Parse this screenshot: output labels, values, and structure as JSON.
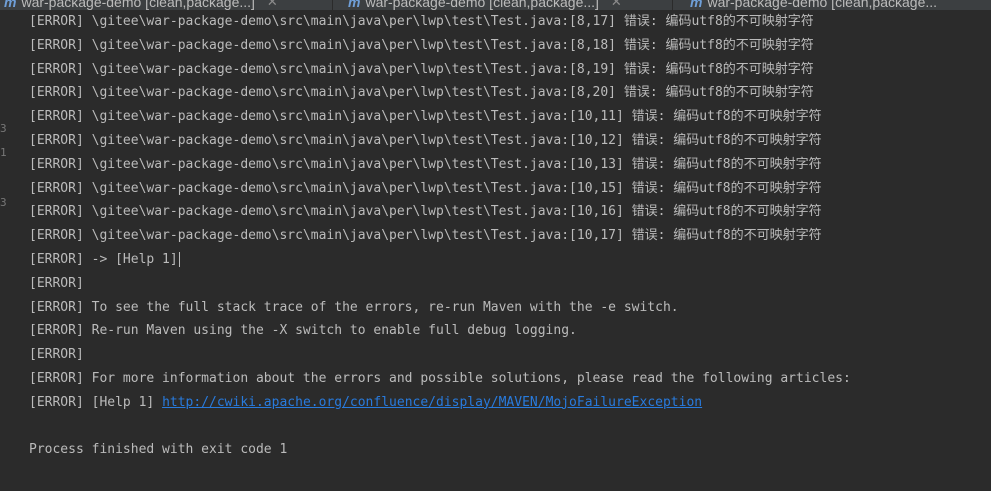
{
  "tabs": [
    {
      "label": "war-package-demo [clean,package...]"
    },
    {
      "label": "war-package-demo [clean,package...]"
    },
    {
      "label": "war-package-demo [clean,package..."
    }
  ],
  "console": {
    "lines": [
      {
        "text": "[ERROR] \\gitee\\war-package-demo\\src\\main\\java\\per\\lwp\\test\\Test.java:[8,17] 错误: 编码utf8的不可映射字符"
      },
      {
        "text": "[ERROR] \\gitee\\war-package-demo\\src\\main\\java\\per\\lwp\\test\\Test.java:[8,18] 错误: 编码utf8的不可映射字符"
      },
      {
        "text": "[ERROR] \\gitee\\war-package-demo\\src\\main\\java\\per\\lwp\\test\\Test.java:[8,19] 错误: 编码utf8的不可映射字符"
      },
      {
        "text": "[ERROR] \\gitee\\war-package-demo\\src\\main\\java\\per\\lwp\\test\\Test.java:[8,20] 错误: 编码utf8的不可映射字符"
      },
      {
        "text": "[ERROR] \\gitee\\war-package-demo\\src\\main\\java\\per\\lwp\\test\\Test.java:[10,11] 错误: 编码utf8的不可映射字符"
      },
      {
        "text": "[ERROR] \\gitee\\war-package-demo\\src\\main\\java\\per\\lwp\\test\\Test.java:[10,12] 错误: 编码utf8的不可映射字符"
      },
      {
        "text": "[ERROR] \\gitee\\war-package-demo\\src\\main\\java\\per\\lwp\\test\\Test.java:[10,13] 错误: 编码utf8的不可映射字符"
      },
      {
        "text": "[ERROR] \\gitee\\war-package-demo\\src\\main\\java\\per\\lwp\\test\\Test.java:[10,15] 错误: 编码utf8的不可映射字符"
      },
      {
        "text": "[ERROR] \\gitee\\war-package-demo\\src\\main\\java\\per\\lwp\\test\\Test.java:[10,16] 错误: 编码utf8的不可映射字符"
      },
      {
        "text": "[ERROR] \\gitee\\war-package-demo\\src\\main\\java\\per\\lwp\\test\\Test.java:[10,17] 错误: 编码utf8的不可映射字符"
      },
      {
        "text": "[ERROR] -> [Help 1]"
      },
      {
        "text": "[ERROR]"
      },
      {
        "text": "[ERROR] To see the full stack trace of the errors, re-run Maven with the -e switch."
      },
      {
        "text": "[ERROR] Re-run Maven using the -X switch to enable full debug logging."
      },
      {
        "text": "[ERROR]"
      },
      {
        "text": "[ERROR] For more information about the errors and possible solutions, please read the following articles:"
      },
      {
        "prefix": "[ERROR] [Help 1] ",
        "link": "http://cwiki.apache.org/confluence/display/MAVEN/MojoFailureException"
      },
      {
        "text": ""
      },
      {
        "text": "Process finished with exit code 1"
      }
    ]
  },
  "colors": {
    "background": "#2b2b2b",
    "text": "#bbbbbb",
    "link": "#287bde",
    "tab_icon": "#6f9fd8"
  }
}
